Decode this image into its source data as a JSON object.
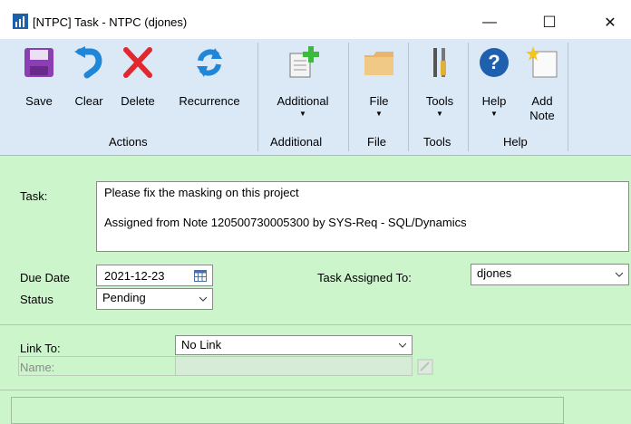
{
  "window": {
    "title": "[NTPC] Task  -  NTPC (djones)",
    "minimize_glyph": "—",
    "maximize_glyph": "☐",
    "close_glyph": "✕"
  },
  "ribbon": {
    "buttons": {
      "save": "Save",
      "clear": "Clear",
      "delete": "Delete",
      "recurrence": "Recurrence",
      "additional": "Additional",
      "file": "File",
      "tools": "Tools",
      "help": "Help",
      "add_note_line1": "Add",
      "add_note_line2": "Note"
    },
    "groups": {
      "actions": "Actions",
      "additional": "Additional",
      "file": "File",
      "tools": "Tools",
      "help": "Help"
    },
    "icons": {
      "save": "floppy-disk-icon",
      "clear": "undo-arrow-icon",
      "delete": "red-x-icon",
      "recurrence": "refresh-arrows-icon",
      "additional": "document-plus-icon",
      "file": "folder-icon",
      "tools": "tools-icon",
      "help": "question-circle-icon",
      "add_note": "note-star-icon"
    },
    "colors": {
      "ribbon_bg": "#dbe9f7",
      "form_bg": "#ccf5cc"
    }
  },
  "form": {
    "task_label": "Task:",
    "task_line1": "Please fix the masking on this project",
    "task_line2": "Assigned from Note 120500730005300 by SYS-Req - SQL/Dynamics",
    "due_date_label": "Due Date",
    "due_date_value": "2021-12-23",
    "status_label": "Status",
    "status_value": "Pending",
    "assigned_to_label": "Task Assigned To:",
    "assigned_to_value": "djones",
    "link_to_label": "Link To:",
    "link_to_value": "No Link",
    "name_label": "Name:",
    "name_value": ""
  }
}
